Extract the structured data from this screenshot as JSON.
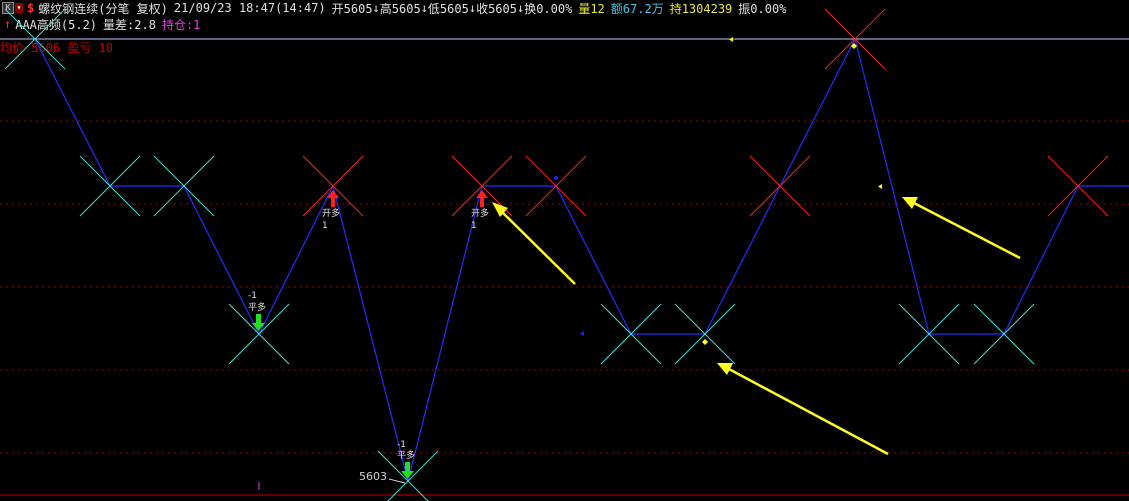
{
  "header": {
    "k_button": "K",
    "dropdown": "▾",
    "symbol_flag": "$",
    "instrument": "螺纹钢连续(分笔 复权)",
    "datetime": "21/09/23 18:47(14:47)",
    "open": "开5605",
    "high": "高5605",
    "low": "低5605",
    "close": "收5605",
    "turnover_rate": "换0.00%",
    "volume": "量12",
    "amount_prefix": "额",
    "amount_value": "67.2万",
    "position": "持1304239",
    "amplitude": "振0.00%"
  },
  "indicator": {
    "arrow": "↑",
    "name": "AAA高频(5.2)",
    "spread": "量差:2.8",
    "holding": "持仓:1"
  },
  "overlay": {
    "avg_label": "均价 5606",
    "pnl_label": "盈亏 10"
  },
  "markers": [
    {
      "line1": "-1",
      "line2": "平多"
    },
    {
      "line1": "开多",
      "line2": "1"
    },
    {
      "line1": "开多",
      "line2": "1"
    },
    {
      "line1": "-1",
      "line2": "平多"
    }
  ],
  "price_label": "5603",
  "colors": {
    "line": "#2a2aff",
    "cross_up": "#40e0d0",
    "cross_down": "#ff2020",
    "arrow": "#ffff20",
    "grid": "#a00000"
  }
}
